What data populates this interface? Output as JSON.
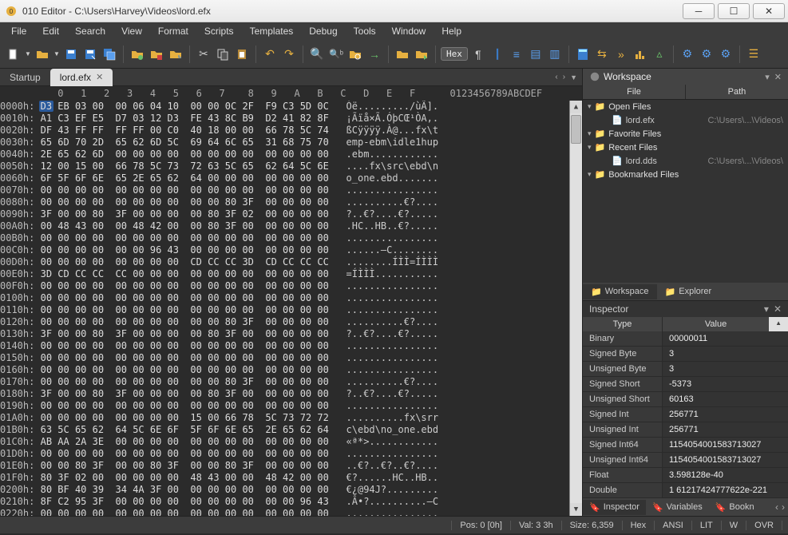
{
  "app": {
    "title": "010 Editor - C:\\Users\\Harvey\\Videos\\lord.efx"
  },
  "menu": [
    "File",
    "Edit",
    "Search",
    "View",
    "Format",
    "Scripts",
    "Templates",
    "Debug",
    "Tools",
    "Window",
    "Help"
  ],
  "toolbar": {
    "hex_label": "Hex"
  },
  "tabs": {
    "startup": "Startup",
    "active": "lord.efx"
  },
  "hex": {
    "header_offsets": "          0   1   2   3   4   5   6   7    8   9   A   B   C   D   E   F",
    "header_ascii": "0123456789ABCDEF",
    "rows": [
      {
        "addr": "0000h:",
        "bytes": "D3 EB 03 00  00 06 04 10  00 00 0C 2F  F9 C3 5D 0C",
        "ascii": "Óë........./ùÃ]."
      },
      {
        "addr": "0010h:",
        "bytes": "A1 C3 EF E5  D7 03 12 D3  FE 43 8C B9  D2 41 82 8F",
        "ascii": "¡Ãïå×Ã.ÓþCŒ¹ÒA‚."
      },
      {
        "addr": "0020h:",
        "bytes": "DF 43 FF FF  FF FF 00 C0  40 18 00 00  66 78 5C 74",
        "ascii": "ßCÿÿÿÿ.À@...fx\\t"
      },
      {
        "addr": "0030h:",
        "bytes": "65 6D 70 2D  65 62 6D 5C  69 64 6C 65  31 68 75 70",
        "ascii": "emp-ebm\\idle1hup"
      },
      {
        "addr": "0040h:",
        "bytes": "2E 65 62 6D  00 00 00 00  00 00 00 00  00 00 00 00",
        "ascii": ".ebm............"
      },
      {
        "addr": "0050h:",
        "bytes": "12 00 15 00  66 78 5C 73  72 63 5C 65  62 64 5C 6E",
        "ascii": "....fx\\src\\ebd\\n"
      },
      {
        "addr": "0060h:",
        "bytes": "6F 5F 6F 6E  65 2E 65 62  64 00 00 00  00 00 00 00",
        "ascii": "o_one.ebd......."
      },
      {
        "addr": "0070h:",
        "bytes": "00 00 00 00  00 00 00 00  00 00 00 00  00 00 00 00",
        "ascii": "................"
      },
      {
        "addr": "0080h:",
        "bytes": "00 00 00 00  00 00 00 00  00 00 80 3F  00 00 00 00",
        "ascii": "..........€?...."
      },
      {
        "addr": "0090h:",
        "bytes": "3F 00 00 80  3F 00 00 00  00 80 3F 02  00 00 00 00",
        "ascii": "?..€?....€?....."
      },
      {
        "addr": "00A0h:",
        "bytes": "00 48 43 00  00 48 42 00  00 80 3F 00  00 00 00 00",
        "ascii": ".HC..HB..€?....."
      },
      {
        "addr": "00B0h:",
        "bytes": "00 00 00 00  00 00 00 00  00 00 00 00  00 00 00 00",
        "ascii": "................"
      },
      {
        "addr": "00C0h:",
        "bytes": "00 00 00 00  00 00 96 43  00 00 00 00  00 00 00 00",
        "ascii": "......–C........"
      },
      {
        "addr": "00D0h:",
        "bytes": "00 00 00 00  00 00 00 00  CD CC CC 3D  CD CC CC CC",
        "ascii": "........ÍÌÌ=ÍÌÌÌ"
      },
      {
        "addr": "00E0h:",
        "bytes": "3D CD CC CC  CC 00 00 00  00 00 00 00  00 00 00 00",
        "ascii": "=ÍÌÌÌ..........."
      },
      {
        "addr": "00F0h:",
        "bytes": "00 00 00 00  00 00 00 00  00 00 00 00  00 00 00 00",
        "ascii": "................"
      },
      {
        "addr": "0100h:",
        "bytes": "00 00 00 00  00 00 00 00  00 00 00 00  00 00 00 00",
        "ascii": "................"
      },
      {
        "addr": "0110h:",
        "bytes": "00 00 00 00  00 00 00 00  00 00 00 00  00 00 00 00",
        "ascii": "................"
      },
      {
        "addr": "0120h:",
        "bytes": "00 00 00 00  00 00 00 00  00 00 80 3F  00 00 00 00",
        "ascii": "..........€?...."
      },
      {
        "addr": "0130h:",
        "bytes": "3F 00 00 80  3F 00 00 00  00 80 3F 00  00 00 00 00",
        "ascii": "?..€?....€?....."
      },
      {
        "addr": "0140h:",
        "bytes": "00 00 00 00  00 00 00 00  00 00 00 00  00 00 00 00",
        "ascii": "................"
      },
      {
        "addr": "0150h:",
        "bytes": "00 00 00 00  00 00 00 00  00 00 00 00  00 00 00 00",
        "ascii": "................"
      },
      {
        "addr": "0160h:",
        "bytes": "00 00 00 00  00 00 00 00  00 00 00 00  00 00 00 00",
        "ascii": "................"
      },
      {
        "addr": "0170h:",
        "bytes": "00 00 00 00  00 00 00 00  00 00 80 3F  00 00 00 00",
        "ascii": "..........€?...."
      },
      {
        "addr": "0180h:",
        "bytes": "3F 00 00 80  3F 00 00 00  00 80 3F 00  00 00 00 00",
        "ascii": "?..€?....€?....."
      },
      {
        "addr": "0190h:",
        "bytes": "00 00 00 00  00 00 00 00  00 00 00 00  00 00 00 00",
        "ascii": "................"
      },
      {
        "addr": "01A0h:",
        "bytes": "00 00 00 00  00 00 00 00  15 00 66 78  5C 73 72 72",
        "ascii": "..........fx\\srr"
      },
      {
        "addr": "01B0h:",
        "bytes": "63 5C 65 62  64 5C 6E 6F  5F 6F 6E 65  2E 65 62 64",
        "ascii": "c\\ebd\\no_one.ebd"
      },
      {
        "addr": "01C0h:",
        "bytes": "AB AA 2A 3E  00 00 00 00  00 00 00 00  00 00 00 00",
        "ascii": "«ª*>............"
      },
      {
        "addr": "01D0h:",
        "bytes": "00 00 00 00  00 00 00 00  00 00 00 00  00 00 00 00",
        "ascii": "................"
      },
      {
        "addr": "01E0h:",
        "bytes": "00 00 80 3F  00 00 80 3F  00 00 80 3F  00 00 00 00",
        "ascii": "..€?..€?..€?...."
      },
      {
        "addr": "01F0h:",
        "bytes": "80 3F 02 00  00 00 00 00  48 43 00 00  48 42 00 00",
        "ascii": "€?......HC..HB.."
      },
      {
        "addr": "0200h:",
        "bytes": "80 BF 40 39  34 4A 3F 00  00 00 00 00  00 00 00 00",
        "ascii": "€¿@94J?........."
      },
      {
        "addr": "0210h:",
        "bytes": "8F C2 95 3F  00 00 00 00  00 00 00 00  00 00 96 43",
        "ascii": ".Â•?..........–C"
      },
      {
        "addr": "0220h:",
        "bytes": "00 00 00 00  00 00 00 00  00 00 00 00  00 00 00 00",
        "ascii": "................"
      }
    ]
  },
  "workspace": {
    "title": "Workspace",
    "columns": {
      "file": "File",
      "path": "Path"
    },
    "items": [
      {
        "label": "Open Files",
        "children": [
          {
            "name": "lord.efx",
            "path": "C:\\Users\\...\\Videos\\"
          }
        ]
      },
      {
        "label": "Favorite Files",
        "children": []
      },
      {
        "label": "Recent Files",
        "children": [
          {
            "name": "lord.dds",
            "path": "C:\\Users\\...\\Videos\\"
          }
        ]
      },
      {
        "label": "Bookmarked Files",
        "children": []
      }
    ],
    "tabs": {
      "workspace": "Workspace",
      "explorer": "Explorer"
    }
  },
  "inspector": {
    "title": "Inspector",
    "columns": {
      "type": "Type",
      "value": "Value"
    },
    "rows": [
      {
        "k": "Binary",
        "v": "00000011"
      },
      {
        "k": "Signed Byte",
        "v": "3"
      },
      {
        "k": "Unsigned Byte",
        "v": "3"
      },
      {
        "k": "Signed Short",
        "v": "-5373"
      },
      {
        "k": "Unsigned Short",
        "v": "60163"
      },
      {
        "k": "Signed Int",
        "v": "256771"
      },
      {
        "k": "Unsigned Int",
        "v": "256771"
      },
      {
        "k": "Signed Int64",
        "v": "1154054001583713027"
      },
      {
        "k": "Unsigned Int64",
        "v": "1154054001583713027"
      },
      {
        "k": "Float",
        "v": "3.598128e-40"
      },
      {
        "k": "Double",
        "v": "1 61217424777622e-221"
      }
    ],
    "tabs": {
      "inspector": "Inspector",
      "variables": "Variables",
      "bookmarks": "Bookn"
    }
  },
  "status": {
    "pos": "Pos: 0 [0h]",
    "val": "Val: 3 3h",
    "size": "Size: 6,359",
    "hex": "Hex",
    "ansi": "ANSI",
    "lit": "LIT",
    "w": "W",
    "ovr": "OVR"
  }
}
